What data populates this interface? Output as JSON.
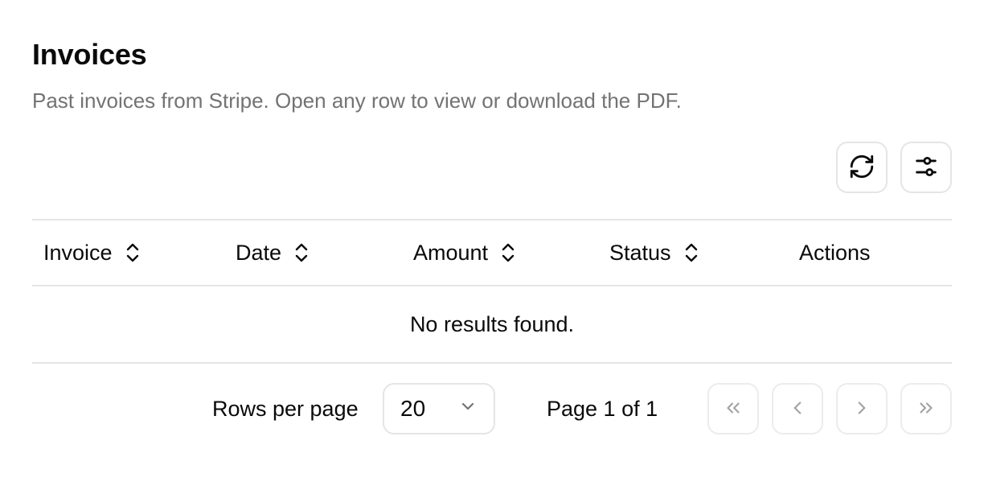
{
  "header": {
    "title": "Invoices",
    "subtitle": "Past invoices from Stripe. Open any row to view or download the PDF."
  },
  "toolbar": {
    "refresh_icon": "refresh-icon",
    "view_options_icon": "sliders-icon"
  },
  "table": {
    "columns": [
      {
        "label": "Invoice",
        "sortable": true
      },
      {
        "label": "Date",
        "sortable": true
      },
      {
        "label": "Amount",
        "sortable": true
      },
      {
        "label": "Status",
        "sortable": true
      },
      {
        "label": "Actions",
        "sortable": false
      }
    ],
    "empty_message": "No results found."
  },
  "pagination": {
    "rows_per_page_label": "Rows per page",
    "rows_per_page_value": "20",
    "page_info": "Page 1 of 1",
    "first_page_enabled": false,
    "prev_page_enabled": false,
    "next_page_enabled": false,
    "last_page_enabled": false
  },
  "colors": {
    "text": "#0a0a0a",
    "muted": "#737373",
    "border": "#e5e5e5",
    "disabled_icon": "#a3a3a3"
  }
}
